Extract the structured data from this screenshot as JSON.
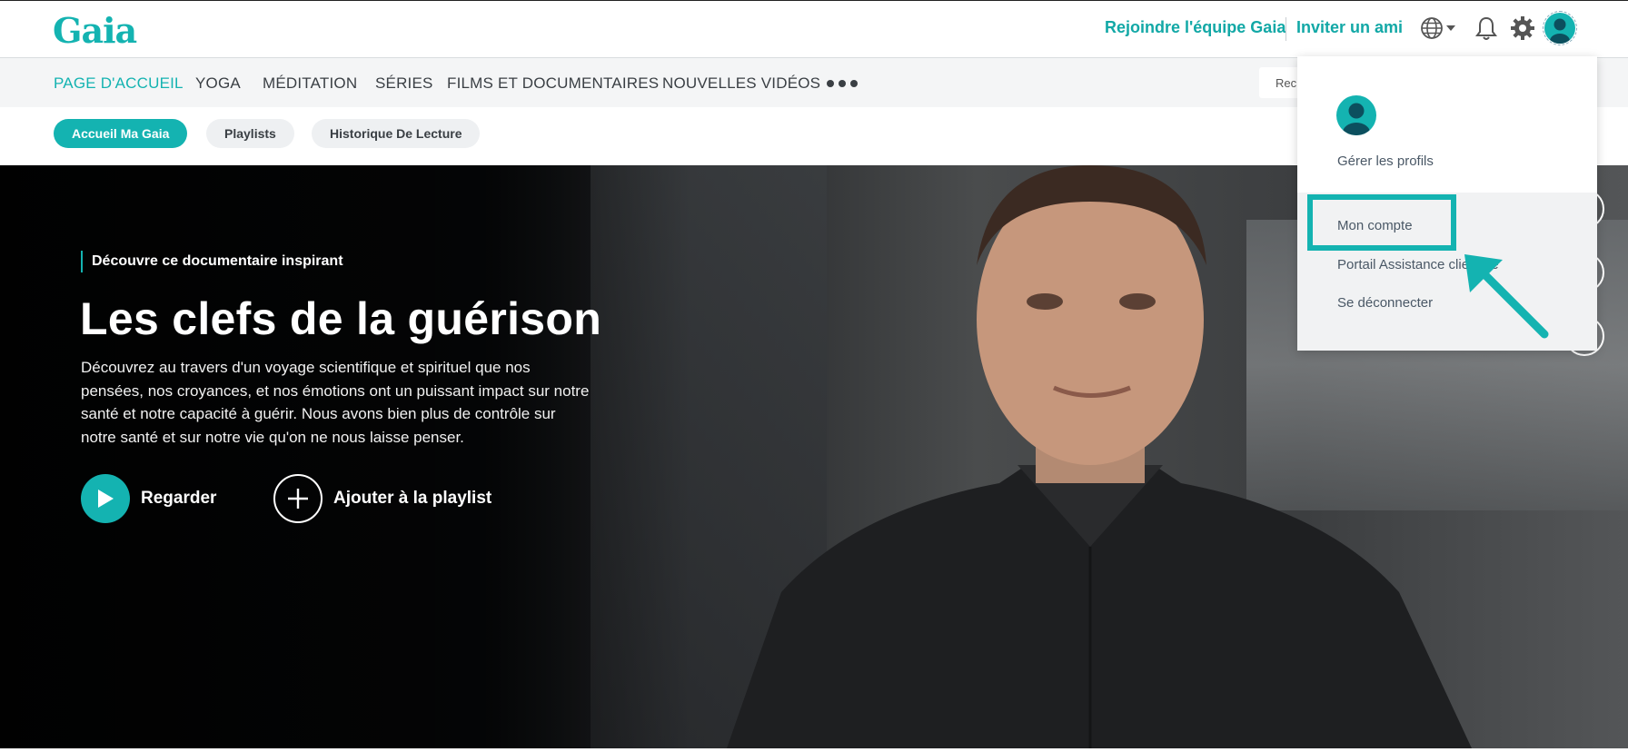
{
  "header": {
    "logo": "Gaia",
    "join_link": "Rejoindre l'équipe Gaia",
    "invite_link": "Inviter un ami",
    "icons": [
      "globe-icon",
      "caret-down-icon",
      "bell-icon",
      "gear-icon",
      "avatar-icon"
    ]
  },
  "nav": {
    "items": [
      {
        "label": "PAGE D'ACCUEIL",
        "active": true
      },
      {
        "label": "YOGA",
        "active": false
      },
      {
        "label": "MÉDITATION",
        "active": false
      },
      {
        "label": "SÉRIES",
        "active": false
      },
      {
        "label": "FILMS ET DOCUMENTAIRES",
        "active": false
      },
      {
        "label": "NOUVELLES VIDÉOS",
        "active": false
      }
    ],
    "search_placeholder": "Rech"
  },
  "subnav": {
    "pills": [
      {
        "label": "Accueil Ma Gaia",
        "active": true
      },
      {
        "label": "Playlists",
        "active": false
      },
      {
        "label": "Historique De Lecture",
        "active": false
      }
    ]
  },
  "hero": {
    "eyebrow": "Découvre ce documentaire inspirant",
    "title": "Les clefs de la guérison",
    "description": "Découvrez au travers d'un voyage scientifique et spirituel que nos pensées, nos croyances, et nos émotions ont un puissant impact sur notre santé et notre capacité à guérir. Nous avons bien plus de contrôle sur notre santé et sur notre vie qu'on ne nous laisse penser.",
    "watch_label": "Regarder",
    "add_label": "Ajouter à la playlist"
  },
  "dropdown": {
    "manage_profiles": "Gérer les profils",
    "items": [
      "Mon compte",
      "Portail Assistance clientèle",
      "Se déconnecter"
    ]
  },
  "colors": {
    "accent": "#14b3b1",
    "nav_bg": "#f4f5f6",
    "text_dark": "#3a3f44"
  }
}
